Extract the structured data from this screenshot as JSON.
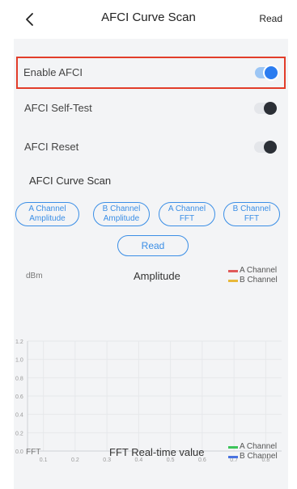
{
  "header": {
    "title": "AFCI Curve Scan",
    "action_label": "Read",
    "back_icon": "chevron-left-icon"
  },
  "settings": {
    "enable_afci": {
      "label": "Enable AFCI",
      "on": true
    },
    "self_test": {
      "label": "AFCI Self-Test",
      "on": false
    },
    "reset": {
      "label": "AFCI Reset",
      "on": false
    }
  },
  "scan": {
    "title": "AFCI Curve Scan",
    "buttons": [
      {
        "line1": "A Channel",
        "line2": "Amplitude"
      },
      {
        "line1": "B Channel",
        "line2": "Amplitude"
      },
      {
        "line1": "A Channel",
        "line2": "FFT"
      },
      {
        "line1": "B Channel",
        "line2": "FFT"
      }
    ],
    "read_label": "Read"
  },
  "amplitude_chart": {
    "unit": "dBm",
    "title": "Amplitude",
    "legend": [
      {
        "label": "A Channel",
        "color": "#e05a5a"
      },
      {
        "label": "B Channel",
        "color": "#e8b83a"
      }
    ]
  },
  "fft_chart": {
    "unit": "FFT",
    "title": "FFT Real-time value",
    "legend": [
      {
        "label": "A Channel",
        "color": "#3cc45a"
      },
      {
        "label": "B Channel",
        "color": "#4a73e0"
      }
    ]
  },
  "chart_data": {
    "type": "line",
    "title": "Amplitude",
    "xlabel": "",
    "ylabel": "dBm",
    "x_ticks": [
      "0.1",
      "0.2",
      "0.3",
      "0.4",
      "0.5",
      "0.6",
      "0.7",
      "0.8"
    ],
    "y_ticks": [
      "0.0",
      "0.2",
      "0.4",
      "0.6",
      "0.8",
      "1.0",
      "1.2"
    ],
    "xlim": [
      0.05,
      0.85
    ],
    "ylim": [
      0,
      1.2
    ],
    "grid": true,
    "legend_position": "top-right",
    "series": [
      {
        "name": "A Channel",
        "color": "#e05a5a",
        "values": []
      },
      {
        "name": "B Channel",
        "color": "#e8b83a",
        "values": []
      }
    ]
  }
}
